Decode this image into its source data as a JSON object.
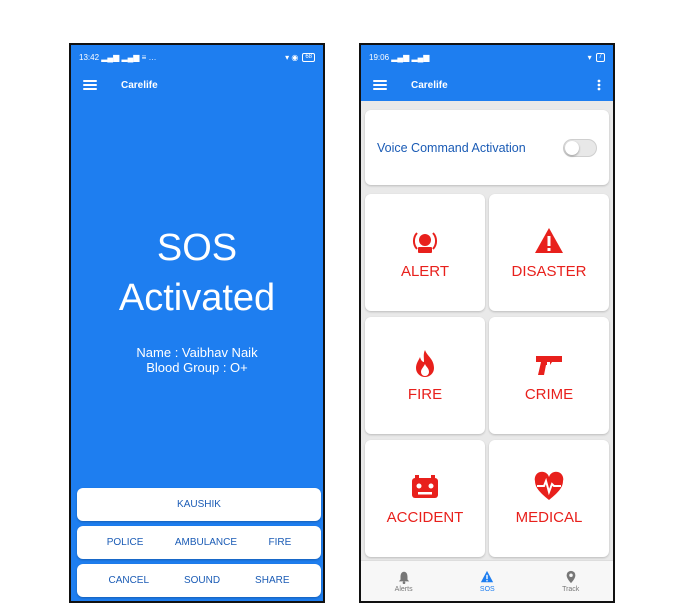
{
  "left": {
    "status": {
      "time": "13:42",
      "signal": "▂▄▆ ▂▄▆ ≡ …",
      "right": "▾ ◉",
      "battery": "68"
    },
    "appbar": {
      "title": "Carelife"
    },
    "sos": {
      "line1": "SOS",
      "line2": "Activated"
    },
    "info": {
      "name": "Name : Vaibhav Naik",
      "blood": "Blood Group : O+"
    },
    "contact": "KAUSHIK",
    "services": [
      "POLICE",
      "AMBULANCE",
      "FIRE"
    ],
    "actions": [
      "CANCEL",
      "SOUND",
      "SHARE"
    ]
  },
  "right": {
    "status": {
      "time": "19:06",
      "signal": "▂▄▆ ▂▄▆",
      "right": "▾",
      "battery": "7"
    },
    "appbar": {
      "title": "Carelife"
    },
    "voice": {
      "label": "Voice Command Activation",
      "enabled": false
    },
    "tiles": [
      {
        "label": "ALERT",
        "icon": "alarm-icon"
      },
      {
        "label": "DISASTER",
        "icon": "warning-icon"
      },
      {
        "label": "FIRE",
        "icon": "fire-icon"
      },
      {
        "label": "CRIME",
        "icon": "gun-icon"
      },
      {
        "label": "ACCIDENT",
        "icon": "car-crash-icon"
      },
      {
        "label": "MEDICAL",
        "icon": "heart-pulse-icon"
      }
    ],
    "nav": [
      {
        "label": "Alerts",
        "icon": "bell-icon",
        "active": false
      },
      {
        "label": "SOS",
        "icon": "warning-icon",
        "active": true
      },
      {
        "label": "Track",
        "icon": "location-pin-icon",
        "active": false
      }
    ]
  },
  "colors": {
    "primary": "#1e7ef0",
    "button_text": "#1a5bb5",
    "tile_red": "#e8201c",
    "background_gray": "#e9e9e9"
  }
}
